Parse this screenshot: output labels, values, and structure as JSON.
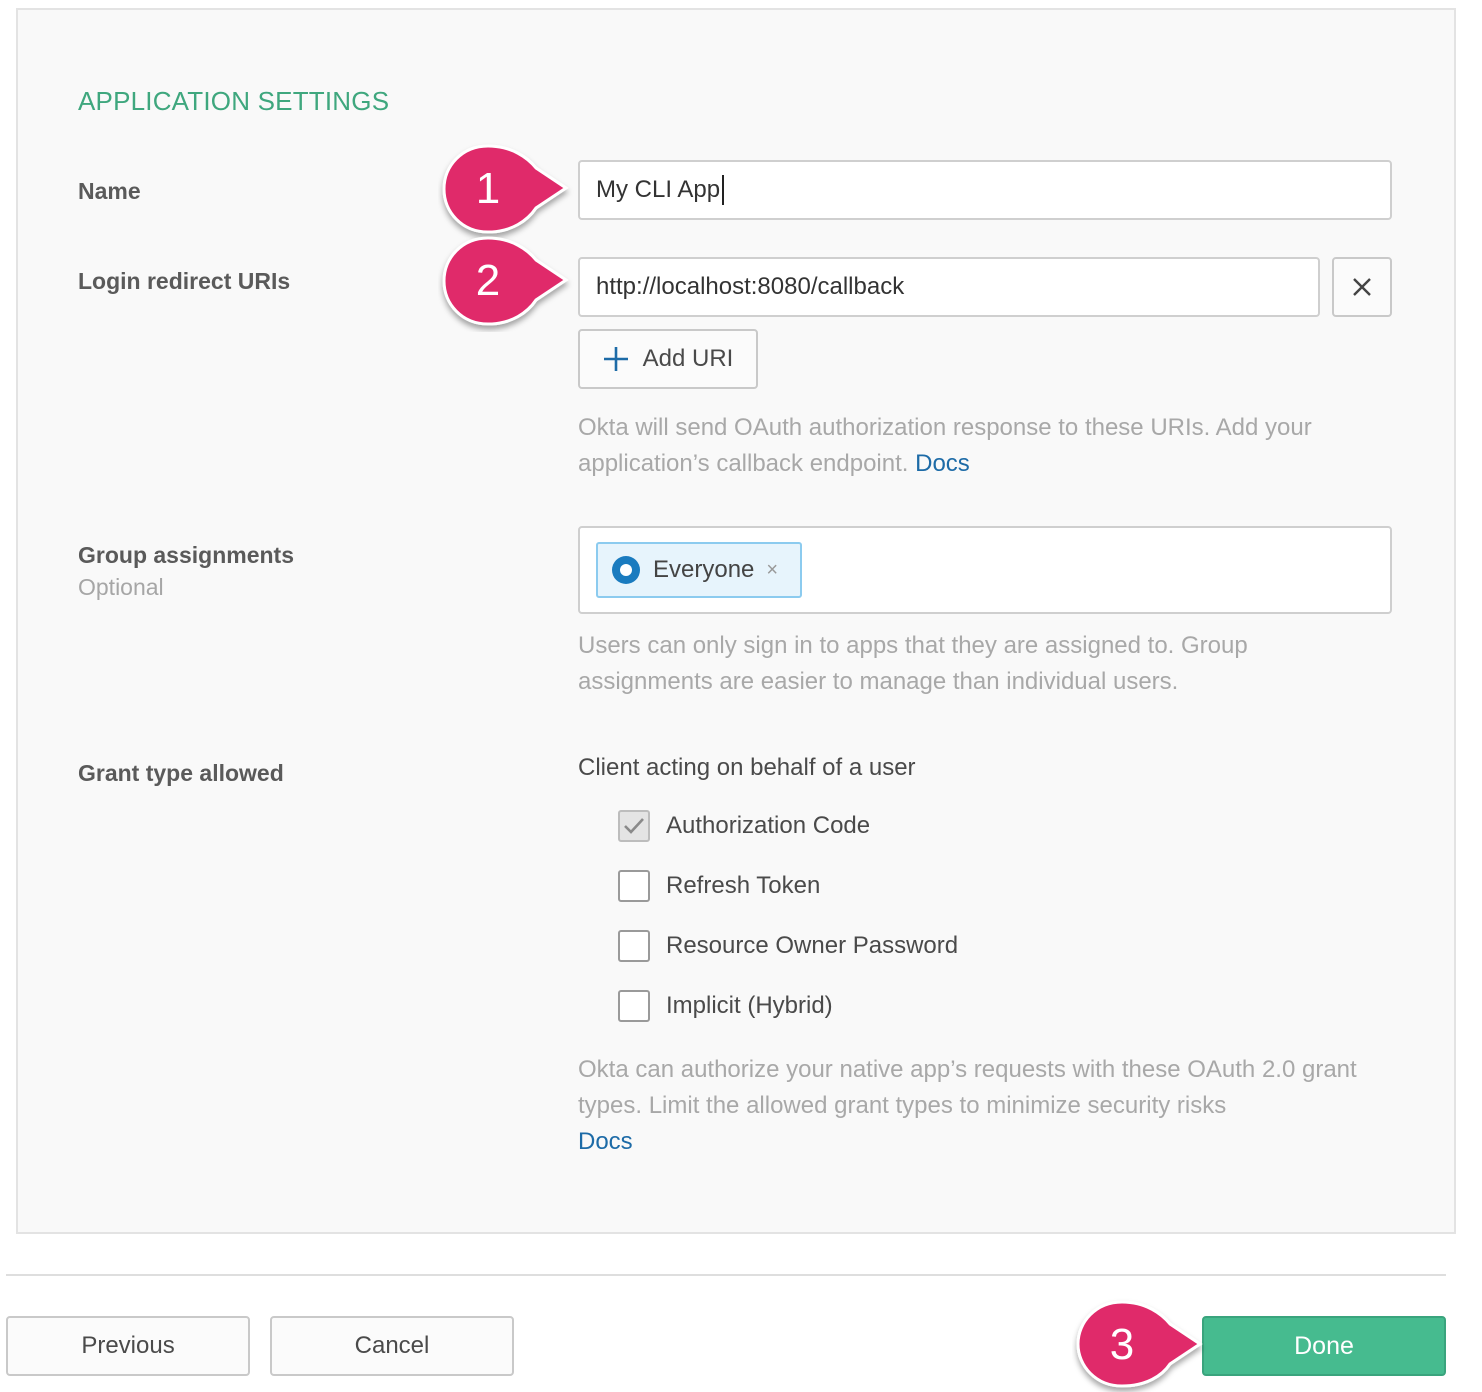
{
  "section_title": "APPLICATION SETTINGS",
  "name": {
    "label": "Name",
    "value": "My CLI App"
  },
  "redirect": {
    "label": "Login redirect URIs",
    "uri_value": "http://localhost:8080/callback",
    "remove_icon": "close-icon",
    "add_button": "Add URI",
    "add_icon": "plus-icon",
    "help_text": "Okta will send OAuth authorization response to these URIs. Add your application’s callback endpoint.",
    "help_link": "Docs"
  },
  "groups": {
    "label": "Group assignments",
    "sublabel": "Optional",
    "tag_label": "Everyone",
    "tag_remove": "×",
    "help_text": "Users can only sign in to apps that they are assigned to. Group assignments are easier to manage than individual users."
  },
  "grant": {
    "label": "Grant type allowed",
    "heading": "Client acting on behalf of a user",
    "options": [
      {
        "label": "Authorization Code",
        "checked": true
      },
      {
        "label": "Refresh Token",
        "checked": false
      },
      {
        "label": "Resource Owner Password",
        "checked": false
      },
      {
        "label": "Implicit (Hybrid)",
        "checked": false
      }
    ],
    "help_text": "Okta can authorize your native app’s requests with these OAuth 2.0 grant types. Limit the allowed grant types to minimize security risks",
    "help_link": "Docs"
  },
  "footer": {
    "previous": "Previous",
    "cancel": "Cancel",
    "done": "Done"
  },
  "markers": [
    "1",
    "2",
    "3"
  ],
  "colors": {
    "accent_green": "#3fa77e",
    "done_button": "#46bb8f",
    "link": "#1d6ba7",
    "marker": "#e0296b"
  }
}
